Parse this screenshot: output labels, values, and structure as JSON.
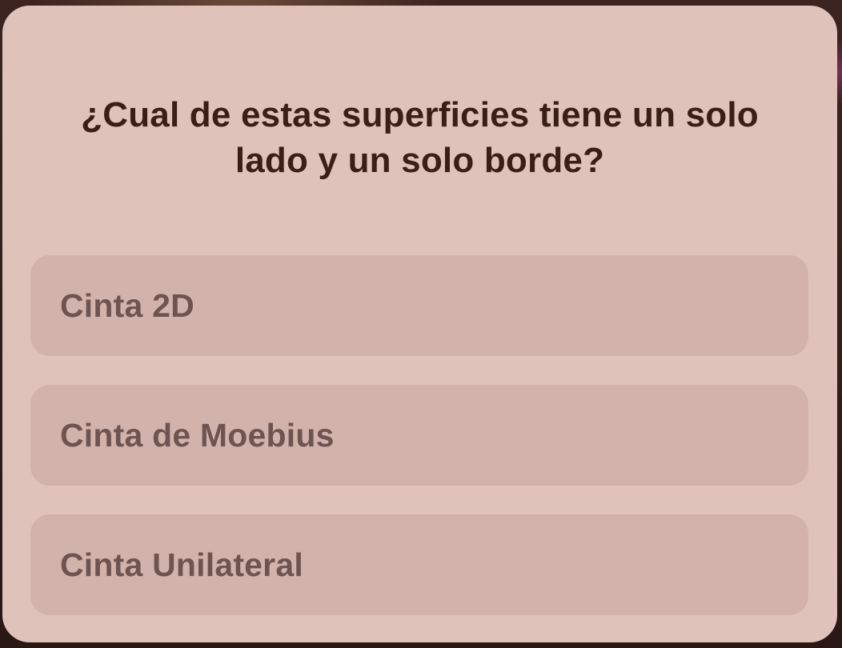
{
  "quiz": {
    "question": "¿Cual de estas superficies tiene un solo lado y un solo borde?",
    "options": [
      {
        "label": "Cinta 2D"
      },
      {
        "label": "Cinta de Moebius"
      },
      {
        "label": "Cinta Unilateral"
      }
    ]
  },
  "colors": {
    "dialog_background": "#dfc3ba",
    "option_background": "#d2b3ac",
    "question_text": "#3a1f19",
    "option_text": "#6e5450"
  }
}
